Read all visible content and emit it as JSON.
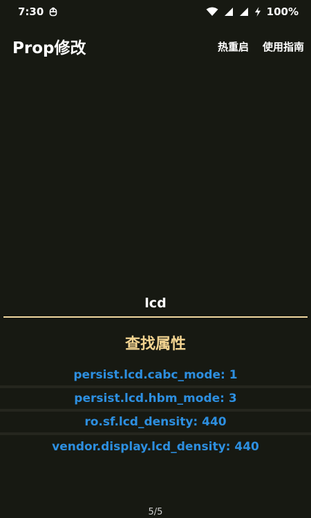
{
  "status_bar": {
    "time": "7:30",
    "battery": "100%",
    "icons": [
      "notification-app-icon",
      "wifi-icon",
      "signal-icon",
      "signal-icon",
      "charging-icon"
    ]
  },
  "app_bar": {
    "title": "Prop修改",
    "actions": [
      "热重启",
      "使用指南"
    ]
  },
  "search": {
    "value": "lcd"
  },
  "section": {
    "title": "查找属性"
  },
  "results": [
    "persist.lcd.cabc_mode: 1",
    "persist.lcd.hbm_mode: 3",
    "ro.sf.lcd_density: 440",
    "vendor.display.lcd_density: 440"
  ],
  "page_indicator": "5/5",
  "colors": {
    "background": "#171912",
    "accent": "#f3d491",
    "result_text": "#2d8fe0"
  }
}
